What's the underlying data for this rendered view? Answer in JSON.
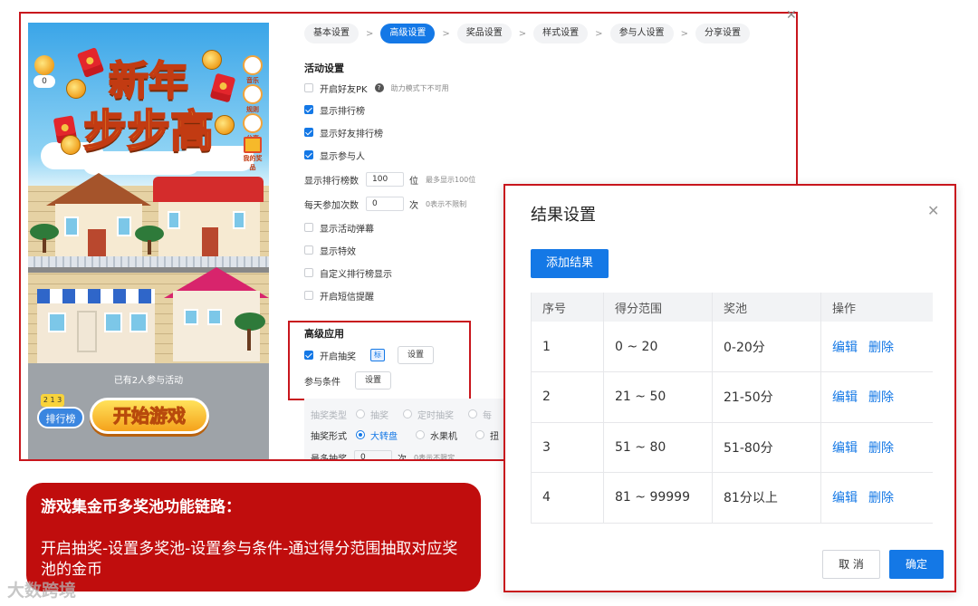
{
  "preview": {
    "title_line1": "新年",
    "title_line2": "步步高",
    "coin_count": "0",
    "side_icons": [
      "音乐",
      "规则",
      "分享",
      "我的奖品"
    ],
    "participants": "已有2人参与活动",
    "rank_label": "排行榜",
    "rank_badge": "2 1 3",
    "start_label": "开始游戏"
  },
  "steps": [
    {
      "label": "基本设置",
      "active": false
    },
    {
      "label": "高级设置",
      "active": true
    },
    {
      "label": "奖品设置",
      "active": false
    },
    {
      "label": "样式设置",
      "active": false
    },
    {
      "label": "参与人设置",
      "active": false
    },
    {
      "label": "分享设置",
      "active": false
    }
  ],
  "step_separator": ">",
  "activity": {
    "section_title": "活动设置",
    "friend_pk": {
      "label": "开启好友PK",
      "hint": "助力模式下不可用",
      "checked": false
    },
    "show_rank": {
      "label": "显示排行榜",
      "checked": true
    },
    "show_friend_rank": {
      "label": "显示好友排行榜",
      "checked": true
    },
    "show_participants": {
      "label": "显示参与人",
      "checked": true
    },
    "rank_count": {
      "label": "显示排行榜数",
      "value": "100",
      "unit": "位",
      "hint": "最多显示100位"
    },
    "daily_count": {
      "label": "每天参加次数",
      "value": "0",
      "unit": "次",
      "hint": "0表示不限制"
    },
    "show_barrage": {
      "label": "显示活动弹幕",
      "checked": false
    },
    "show_effects": {
      "label": "显示特效",
      "checked": false
    },
    "custom_rank": {
      "label": "自定义排行榜显示",
      "checked": false
    },
    "sms_remind": {
      "label": "开启短信提醒",
      "checked": false
    }
  },
  "advanced": {
    "section_title": "高级应用",
    "lottery_label": "开启抽奖",
    "lottery_checked": true,
    "tag": "标",
    "setting_button": "设置",
    "condition_label": "参与条件",
    "condition_button": "设置",
    "draw_type_label": "抽奖类型",
    "draw_type_options": [
      "抽奖",
      "定时抽奖",
      "每"
    ],
    "draw_form_label": "抽奖形式",
    "draw_form_options": [
      "大转盘",
      "水果机",
      "扭"
    ],
    "max_label": "最多抽奖",
    "max_value": "0",
    "max_unit": "次",
    "max_hint": "0表示不限定"
  },
  "dialog": {
    "title": "结果设置",
    "add_button": "添加结果",
    "columns": [
      "序号",
      "得分范围",
      "奖池",
      "操作"
    ],
    "rows": [
      {
        "no": "1",
        "range": "0 ~ 20",
        "pool": "0-20分"
      },
      {
        "no": "2",
        "range": "21 ~ 50",
        "pool": "21-50分"
      },
      {
        "no": "3",
        "range": "51 ~ 80",
        "pool": "51-80分"
      },
      {
        "no": "4",
        "range": "81 ~ 99999",
        "pool": "81分以上"
      }
    ],
    "edit_label": "编辑",
    "delete_label": "删除",
    "cancel_button": "取 消",
    "ok_button": "确定"
  },
  "callout": {
    "title": "游戏集金币多奖池功能链路：",
    "body": "开启抽奖-设置多奖池-设置参与条件-通过得分范围抽取对应奖池的金币"
  },
  "watermark": "大数跨境",
  "colors": {
    "accent": "#1478e6",
    "highlight": "#c8161d",
    "callout": "#c00d0d"
  }
}
